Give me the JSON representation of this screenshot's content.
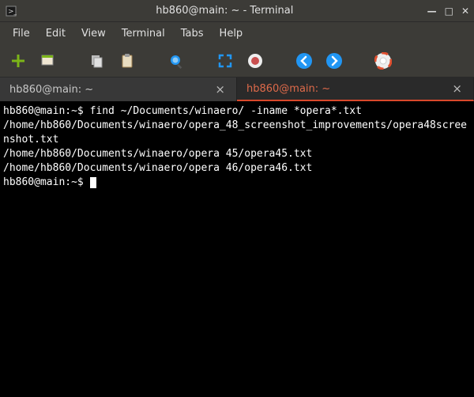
{
  "window": {
    "title": "hb860@main: ~ - Terminal"
  },
  "menubar": {
    "items": [
      "File",
      "Edit",
      "View",
      "Terminal",
      "Tabs",
      "Help"
    ]
  },
  "toolbar": {
    "icons": [
      "add",
      "new-window",
      "copy",
      "paste",
      "zoom",
      "fullscreen",
      "record",
      "back",
      "forward",
      "help"
    ]
  },
  "tabs": [
    {
      "label": "hb860@main: ~",
      "active": false
    },
    {
      "label": "hb860@main: ~",
      "active": true
    }
  ],
  "terminal": {
    "prompt": "hb860@main:~$",
    "command": "find ~/Documents/winaero/ -iname *opera*.txt",
    "output": [
      "/home/hb860/Documents/winaero/opera_48_screenshot_improvements/opera48screenshot.txt",
      "/home/hb860/Documents/winaero/opera 45/opera45.txt",
      "/home/hb860/Documents/winaero/opera 46/opera46.txt"
    ]
  }
}
